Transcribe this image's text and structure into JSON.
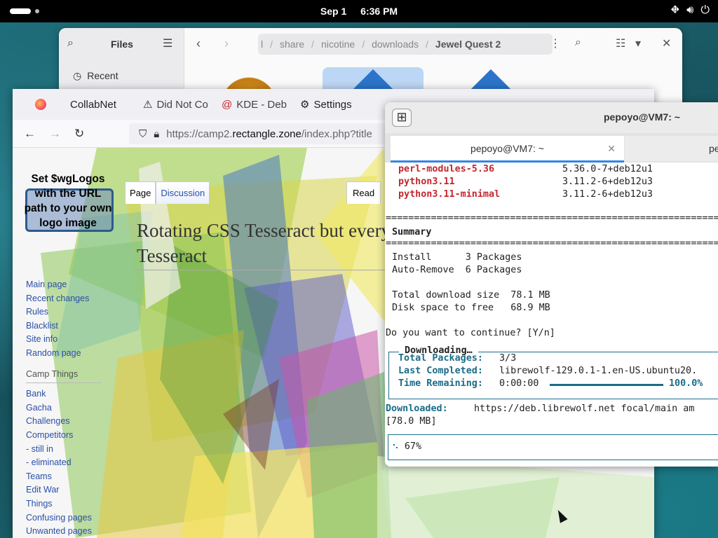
{
  "topbar": {
    "date": "Sep 1",
    "time": "6:36 PM"
  },
  "files": {
    "title": "Files",
    "recent_label": "Recent",
    "breadcrumbs": [
      "share",
      "nicotine",
      "downloads",
      "Jewel Quest 2"
    ]
  },
  "browser": {
    "tabs": [
      {
        "label": "CollabNet",
        "color": "#ff7139"
      },
      {
        "label": "Did Not Co",
        "color": "#222222"
      },
      {
        "label": "KDE - Deb",
        "color": "#c0262d"
      },
      {
        "label": "Settings",
        "color": "#444444"
      }
    ],
    "url_prefix": "https://camp2.",
    "url_domain": "rectangle.zone",
    "url_suffix": "/index.php?title",
    "logo_text": "Set $wgLogos with the URL path to your own logo image",
    "sidebar": {
      "main_links": [
        "Main page",
        "Recent changes",
        "Rules",
        "Blacklist",
        "Site info",
        "Random page"
      ],
      "section_heading": "Camp Things",
      "section_links": [
        "Bank",
        "Gacha",
        "Challenges",
        "Competitors",
        "- still in",
        "- eliminated",
        "Teams",
        "Edit War",
        "Things",
        "Confusing pages",
        "Unwanted pages"
      ]
    },
    "page_tabs": [
      "Page",
      "Discussion"
    ],
    "read_tab": "Read",
    "page_title": "Rotating CSS Tesseract but every Tesseract"
  },
  "terminal": {
    "window_title": "pepoyo@VM7: ~",
    "tab1_label": "pepoyo@VM7: ~",
    "tab2_label": "pe",
    "packages": [
      {
        "name": "perl-modules-5.36",
        "version": "5.36.0-7+deb12u1"
      },
      {
        "name": "python3.11",
        "version": "3.11.2-6+deb12u3"
      },
      {
        "name": "python3.11-minimal",
        "version": "3.11.2-6+deb12u3"
      }
    ],
    "rule": "==========================================================================",
    "summary_label": "Summary",
    "install_line": "Install      3 Packages",
    "autoremove_line": "Auto-Remove  6 Packages",
    "download_size_line": "Total download size  78.1 MB",
    "disk_space_line": "Disk space to free   68.9 MB",
    "prompt_line": "Do you want to continue? [Y/n]",
    "downloading_legend": "Downloading…",
    "total_packages_label": "Total Packages:",
    "total_packages_value": "3/3",
    "last_completed_label": "Last Completed:",
    "last_completed_value": "librewolf-129.0.1-1.en-US.ubuntu20.",
    "time_remaining_label": "Time Remaining:",
    "time_remaining_value": "0:00:00",
    "progress_percent": "100.0%",
    "downloaded_label": "Downloaded:",
    "downloaded_value": "https://deb.librewolf.net focal/main am",
    "downloaded_size": "[78.0 MB]",
    "bottom_progress": "67%"
  }
}
